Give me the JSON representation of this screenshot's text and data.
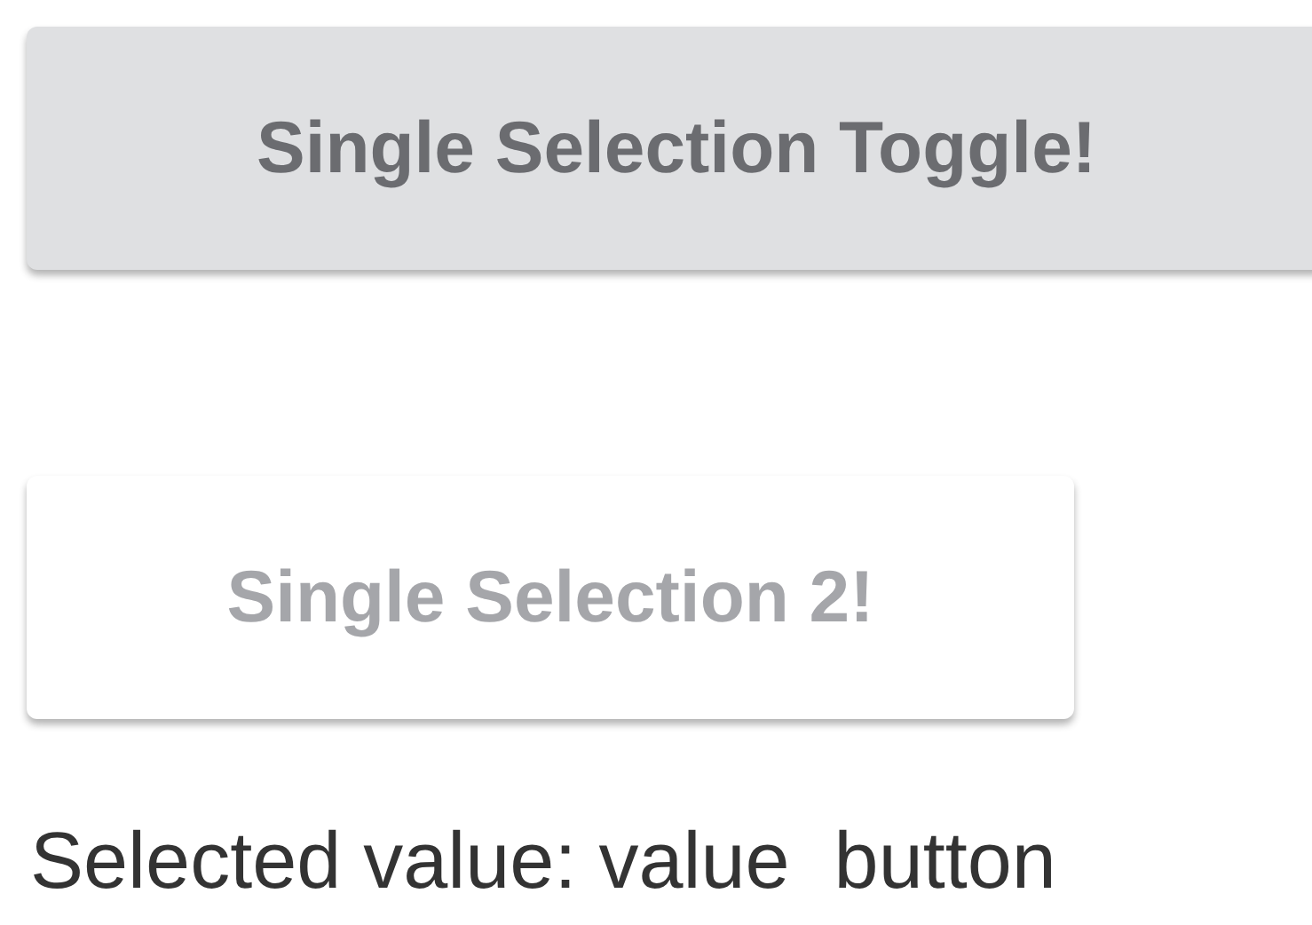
{
  "buttons": [
    {
      "label": "Single Selection Toggle!",
      "selected": true
    },
    {
      "label": "Single Selection 2!",
      "selected": false
    }
  ],
  "selected_value_text": "Selected value: value  button"
}
